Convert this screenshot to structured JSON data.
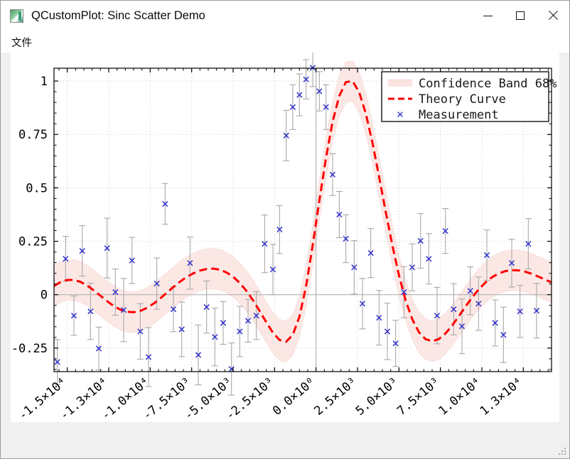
{
  "window": {
    "title": "QCustomPlot: Sinc Scatter Demo",
    "icon": "qcustomplot-app-icon",
    "background": "#f0f0f0",
    "controls": {
      "minimize": "–",
      "maximize": "□",
      "close": "✕"
    }
  },
  "menubar": {
    "items": [
      {
        "label": "文件",
        "name": "menu-file"
      }
    ]
  },
  "chart_data": {
    "type": "scatter",
    "title": "",
    "xlabel": "",
    "ylabel": "",
    "xlim": [
      -15800,
      14200
    ],
    "ylim": [
      -0.36,
      1.06
    ],
    "grid": true,
    "grid_style": "dotted",
    "legend_position": "top-right",
    "background": "#ffffff",
    "y_ticks": [
      "1",
      "0.75",
      "0.5",
      "0.25",
      "0",
      "-0.25"
    ],
    "y_tick_values": [
      1,
      0.75,
      0.5,
      0.25,
      0,
      -0.25
    ],
    "x_ticks": [
      "-1.5×10⁴",
      "-1.3×10⁴",
      "-1.0×10⁴",
      "-7.5×10³",
      "-5.0×10³",
      "-2.5×10³",
      "0.0×10⁰",
      "2.5×10³",
      "5.0×10³",
      "7.5×10³",
      "1.0×10⁴",
      "1.3×10⁴"
    ],
    "x_tick_values": [
      -15000,
      -12500,
      -10000,
      -7500,
      -5000,
      -2500,
      0,
      2500,
      5000,
      7500,
      10000,
      12500
    ],
    "x_tick_label_rotation": -40,
    "legend": [
      {
        "label": "Confidence Band 68%",
        "marker": "band",
        "color": "#fbe3e0"
      },
      {
        "label": "Theory Curve",
        "marker": "dashed",
        "color": "#ff0000"
      },
      {
        "label": "Measurement",
        "marker": "cross",
        "color": "#3333cc"
      }
    ],
    "series": [
      {
        "name": "Theory Curve",
        "type": "line",
        "style": "dashed",
        "color": "#ff0000",
        "formula": "sinc",
        "x": [
          -15800,
          -15400,
          -15000,
          -14600,
          -14200,
          -13800,
          -13400,
          -13000,
          -12600,
          -12200,
          -11800,
          -11400,
          -11000,
          -10600,
          -10200,
          -9800,
          -9400,
          -9000,
          -8600,
          -8200,
          -7800,
          -7400,
          -7000,
          -6600,
          -6200,
          -5800,
          -5400,
          -5000,
          -4600,
          -4200,
          -3800,
          -3400,
          -3000,
          -2600,
          -2200,
          -1800,
          -1400,
          -1000,
          -600,
          -200,
          200,
          600,
          1000,
          1400,
          1800,
          2200,
          2600,
          3000,
          3400,
          3800,
          4200,
          4600,
          5000,
          5400,
          5800,
          6200,
          6600,
          7000,
          7400,
          7800,
          8200,
          8600,
          9000,
          9400,
          9800,
          10200,
          10600,
          11000,
          11400,
          11800,
          12200,
          12600,
          13000,
          13400,
          13800,
          14200
        ],
        "y": [
          0.041,
          0.059,
          0.069,
          0.069,
          0.06,
          0.043,
          0.02,
          -0.005,
          -0.03,
          -0.053,
          -0.07,
          -0.08,
          -0.082,
          -0.076,
          -0.062,
          -0.042,
          -0.018,
          0.009,
          0.036,
          0.061,
          0.083,
          0.1,
          0.113,
          0.12,
          0.122,
          0.117,
          0.104,
          0.084,
          0.055,
          0.018,
          -0.026,
          -0.076,
          -0.129,
          -0.178,
          -0.212,
          -0.22,
          -0.188,
          -0.103,
          0.04,
          0.232,
          0.44,
          0.64,
          0.81,
          0.93,
          0.995,
          1.0,
          0.948,
          0.848,
          0.712,
          0.553,
          0.389,
          0.232,
          0.091,
          -0.026,
          -0.114,
          -0.175,
          -0.208,
          -0.218,
          -0.208,
          -0.182,
          -0.145,
          -0.102,
          -0.057,
          -0.014,
          0.024,
          0.056,
          0.081,
          0.099,
          0.11,
          0.115,
          0.114,
          0.108,
          0.098,
          0.085,
          0.071,
          0.058
        ]
      },
      {
        "name": "Confidence Band 68%",
        "type": "band",
        "fill": "#fbe8e5",
        "border": "#f0c8c2",
        "border_style": "dotted",
        "half_width": 0.095
      },
      {
        "name": "Measurement",
        "type": "scatter",
        "marker": "cross",
        "color": "#3333cc",
        "errorbar_color": "#a8a8a8",
        "points": [
          {
            "x": -15600,
            "y": -0.315,
            "err": 0.105
          },
          {
            "x": -15100,
            "y": 0.168,
            "err": 0.105
          },
          {
            "x": -14600,
            "y": -0.098,
            "err": 0.092
          },
          {
            "x": -14100,
            "y": 0.205,
            "err": 0.118
          },
          {
            "x": -13600,
            "y": -0.078,
            "err": 0.132
          },
          {
            "x": -13100,
            "y": -0.252,
            "err": 0.1
          },
          {
            "x": -12600,
            "y": 0.218,
            "err": 0.14
          },
          {
            "x": -12100,
            "y": 0.012,
            "err": 0.108
          },
          {
            "x": -11600,
            "y": -0.072,
            "err": 0.148
          },
          {
            "x": -11100,
            "y": 0.16,
            "err": 0.108
          },
          {
            "x": -10600,
            "y": -0.172,
            "err": 0.13
          },
          {
            "x": -10100,
            "y": -0.292,
            "err": 0.138
          },
          {
            "x": -9600,
            "y": 0.052,
            "err": 0.12
          },
          {
            "x": -9100,
            "y": 0.425,
            "err": 0.095
          },
          {
            "x": -8600,
            "y": -0.068,
            "err": 0.105
          },
          {
            "x": -8100,
            "y": -0.162,
            "err": 0.128
          },
          {
            "x": -7600,
            "y": 0.148,
            "err": 0.122
          },
          {
            "x": -7100,
            "y": -0.282,
            "err": 0.14
          },
          {
            "x": -6600,
            "y": -0.058,
            "err": 0.122
          },
          {
            "x": -6100,
            "y": -0.198,
            "err": 0.135
          },
          {
            "x": -5600,
            "y": -0.132,
            "err": 0.1
          },
          {
            "x": -5100,
            "y": -0.348,
            "err": 0.122
          },
          {
            "x": -4600,
            "y": -0.172,
            "err": 0.118
          },
          {
            "x": -4100,
            "y": -0.122,
            "err": 0.1
          },
          {
            "x": -3600,
            "y": -0.098,
            "err": 0.112
          },
          {
            "x": -3100,
            "y": 0.238,
            "err": 0.135
          },
          {
            "x": -2600,
            "y": 0.118,
            "err": 0.118
          },
          {
            "x": -2200,
            "y": 0.305,
            "err": 0.112
          },
          {
            "x": -1800,
            "y": 0.745,
            "err": 0.118
          },
          {
            "x": -1400,
            "y": 0.878,
            "err": 0.105
          },
          {
            "x": -1000,
            "y": 0.935,
            "err": 0.098
          },
          {
            "x": -600,
            "y": 1.008,
            "err": 0.092
          },
          {
            "x": -200,
            "y": 1.062,
            "err": 0.088
          },
          {
            "x": 200,
            "y": 0.952,
            "err": 0.092
          },
          {
            "x": 600,
            "y": 0.878,
            "err": 0.105
          },
          {
            "x": 1000,
            "y": 0.562,
            "err": 0.098
          },
          {
            "x": 1400,
            "y": 0.375,
            "err": 0.108
          },
          {
            "x": 1800,
            "y": 0.262,
            "err": 0.112
          },
          {
            "x": 2300,
            "y": 0.128,
            "err": 0.125
          },
          {
            "x": 2800,
            "y": -0.042,
            "err": 0.118
          },
          {
            "x": 3300,
            "y": 0.195,
            "err": 0.115
          },
          {
            "x": 3800,
            "y": -0.108,
            "err": 0.128
          },
          {
            "x": 4300,
            "y": -0.172,
            "err": 0.132
          },
          {
            "x": 4800,
            "y": -0.228,
            "err": 0.108
          },
          {
            "x": 5300,
            "y": 0.012,
            "err": 0.12
          },
          {
            "x": 5800,
            "y": 0.128,
            "err": 0.11
          },
          {
            "x": 6300,
            "y": 0.252,
            "err": 0.128
          },
          {
            "x": 6800,
            "y": 0.168,
            "err": 0.118
          },
          {
            "x": 7300,
            "y": -0.098,
            "err": 0.132
          },
          {
            "x": 7800,
            "y": 0.298,
            "err": 0.105
          },
          {
            "x": 8300,
            "y": -0.068,
            "err": 0.12
          },
          {
            "x": 8800,
            "y": -0.148,
            "err": 0.128
          },
          {
            "x": 9300,
            "y": 0.018,
            "err": 0.112
          },
          {
            "x": 9800,
            "y": -0.042,
            "err": 0.125
          },
          {
            "x": 10300,
            "y": 0.185,
            "err": 0.118
          },
          {
            "x": 10800,
            "y": -0.132,
            "err": 0.108
          },
          {
            "x": 11300,
            "y": -0.188,
            "err": 0.13
          },
          {
            "x": 11800,
            "y": 0.148,
            "err": 0.112
          },
          {
            "x": 12300,
            "y": -0.078,
            "err": 0.122
          },
          {
            "x": 12800,
            "y": 0.238,
            "err": 0.118
          },
          {
            "x": 13300,
            "y": -0.075,
            "err": 0.128
          }
        ]
      }
    ]
  }
}
